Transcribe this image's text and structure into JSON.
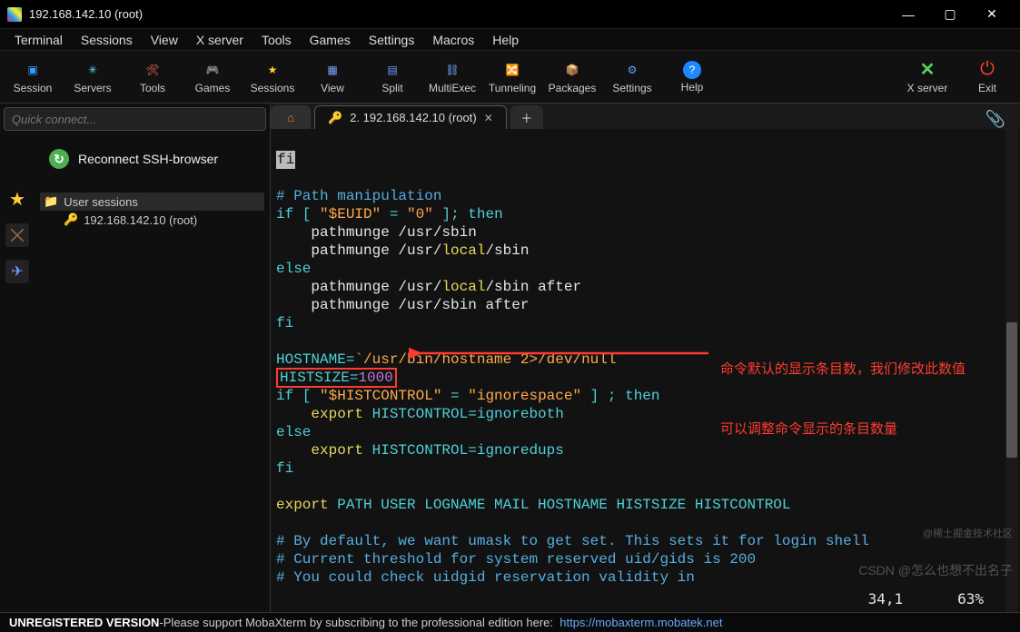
{
  "window": {
    "title": "192.168.142.10 (root)"
  },
  "menubar": [
    "Terminal",
    "Sessions",
    "View",
    "X server",
    "Tools",
    "Games",
    "Settings",
    "Macros",
    "Help"
  ],
  "toolbar": {
    "left": [
      {
        "name": "session",
        "label": "Session",
        "glyph": "▣",
        "color": "#3aa0ff"
      },
      {
        "name": "servers",
        "label": "Servers",
        "glyph": "✳",
        "color": "#6ad1ff"
      },
      {
        "name": "tools",
        "label": "Tools",
        "glyph": "🛠",
        "color": "#ff6b4a"
      },
      {
        "name": "games",
        "label": "Games",
        "glyph": "🎮",
        "color": "#ddd"
      },
      {
        "name": "sessions",
        "label": "Sessions",
        "glyph": "★",
        "color": "#ffcc33"
      },
      {
        "name": "view",
        "label": "View",
        "glyph": "▦",
        "color": "#7aa7ff"
      },
      {
        "name": "split",
        "label": "Split",
        "glyph": "▤",
        "color": "#6aa0ff"
      },
      {
        "name": "multiexec",
        "label": "MultiExec",
        "glyph": "⛓",
        "color": "#7aa7ff"
      },
      {
        "name": "tunneling",
        "label": "Tunneling",
        "glyph": "🔀",
        "color": "#ffb84d"
      },
      {
        "name": "packages",
        "label": "Packages",
        "glyph": "📦",
        "color": "#c98f4a"
      },
      {
        "name": "settings",
        "label": "Settings",
        "glyph": "⚙",
        "color": "#6aa0ff"
      },
      {
        "name": "help",
        "label": "Help",
        "glyph": "?",
        "color": "#1e88ff"
      }
    ],
    "right": [
      {
        "name": "xserver",
        "label": "X server",
        "glyph": "✕",
        "color": "#5ad15a"
      },
      {
        "name": "exit",
        "label": "Exit",
        "glyph": "⏻",
        "color": "#ff4136"
      }
    ]
  },
  "sidebar": {
    "quick_placeholder": "Quick connect...",
    "reconnect_label": "Reconnect SSH-browser",
    "tree": {
      "group_label": "User sessions",
      "item_label": "192.168.142.10 (root)"
    }
  },
  "tabs": {
    "session_label": "2. 192.168.142.10 (root)"
  },
  "terminal": {
    "lines": {
      "fi1": "fi",
      "blank": "",
      "comment1": "# Path manipulation",
      "if_euid_l": "if [ ",
      "if_euid_var": "\"$EUID\"",
      "if_euid_eq": " = ",
      "if_euid_zero": "\"0\"",
      "if_euid_r": " ]; then",
      "pm1_a": "    pathmunge ",
      "pm1_b": "/usr/sbin",
      "pm2_a": "    pathmunge ",
      "pm2_b": "/usr/",
      "pm2_c": "local",
      "pm2_d": "/sbin",
      "else1": "else",
      "pm3_a": "    pathmunge ",
      "pm3_b": "/usr/",
      "pm3_c": "local",
      "pm3_d": "/sbin after",
      "pm4_a": "    pathmunge ",
      "pm4_b": "/usr/sbin after",
      "fi2": "fi",
      "hostname_l": "HOSTNAME=",
      "hostname_v": "`/usr/bin/hostname 2>/dev/null`",
      "histsize_box": "HISTSIZE=",
      "histsize_num": "1000",
      "ifhc_l": "if [ ",
      "ifhc_var": "\"$HISTCONTROL\"",
      "ifhc_mid": " = ",
      "ifhc_val": "\"ignorespace\"",
      "ifhc_r": " ] ; then",
      "exp1_a": "    export",
      "exp1_b": " HISTCONTROL=ignoreboth",
      "else2": "else",
      "exp2_a": "    export",
      "exp2_b": " HISTCONTROL=ignoredups",
      "fi3": "fi",
      "export_line_a": "export",
      "export_line_b": " PATH USER LOGNAME MAIL HOSTNAME HISTSIZE HISTCONTROL",
      "c1": "# By default, we want umask to get set. This sets it for login shell",
      "c2": "# Current threshold for system reserved uid/gids is 200",
      "c3": "# You could check uidgid reservation validity in"
    },
    "status_pos": "34,1",
    "status_pct": "63%"
  },
  "annotation": {
    "line1": "命令默认的显示条目数，我们修改此数值",
    "line2": "可以调整命令显示的条目数量"
  },
  "footer": {
    "unreg": "UNREGISTERED VERSION",
    "sep": "   -   ",
    "msg": "Please support MobaXterm by subscribing to the professional edition here:",
    "url": "https://mobaxterm.mobatek.net"
  },
  "watermark": {
    "top": "@稀土掘金技术社区",
    "bottom": "CSDN @怎么也想不出名子"
  }
}
